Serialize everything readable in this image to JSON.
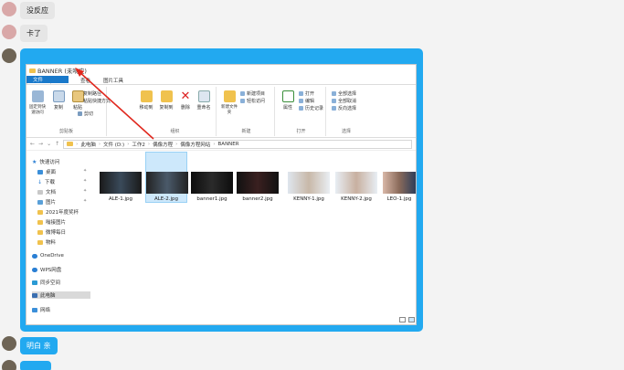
{
  "chat": {
    "msg1": "没反应",
    "msg2": "卡了",
    "msg3": "明白 亲",
    "msg4": ""
  },
  "explorer": {
    "title": "BANNER (未响应)",
    "tabs": [
      "文件",
      "主页",
      "共享",
      "查看",
      "图片工具"
    ],
    "ribbon": {
      "pin": "固定到快速访问",
      "copy": "复制",
      "paste": "粘贴",
      "cut": "剪切",
      "copy_path": "复制路径",
      "paste_shortcut": "粘贴快捷方式",
      "clipboard": "剪贴板",
      "move_to": "移动到",
      "copy_to": "复制到",
      "delete": "删除",
      "rename": "重命名",
      "organize": "组织",
      "new_folder": "新建文件夹",
      "new_item": "新建项目",
      "easy_access": "轻松访问",
      "new": "新建",
      "properties": "属性",
      "open": "打开",
      "edit": "编辑",
      "history": "历史记录",
      "open_group": "打开",
      "select_all": "全部选择",
      "select_none": "全部取消",
      "invert": "反向选择",
      "select": "选择"
    },
    "breadcrumb": [
      "此电脑",
      "文件 (D:)",
      "工作2",
      "偶像方程",
      "偶像方程网站",
      "BANNER"
    ],
    "nav": {
      "quick_access": "快速访问",
      "desktop": "桌面",
      "downloads": "下载",
      "documents": "文档",
      "pictures": "图片",
      "folder1": "2021年度奖杯",
      "folder2": "嗡接图片",
      "folder3": "微博每日",
      "folder4": "物料",
      "onedrive": "OneDrive",
      "wps": "WPS网盘",
      "sync": "同步空间",
      "this_pc": "此电脑",
      "network": "网络"
    },
    "files": [
      "ALE-1.jpg",
      "ALE-2.jpg",
      "banner1.jpg",
      "banner2.jpg",
      "KENNY-1.jpg",
      "KENNY-2.jpg",
      "LEO-1.jpg"
    ]
  }
}
